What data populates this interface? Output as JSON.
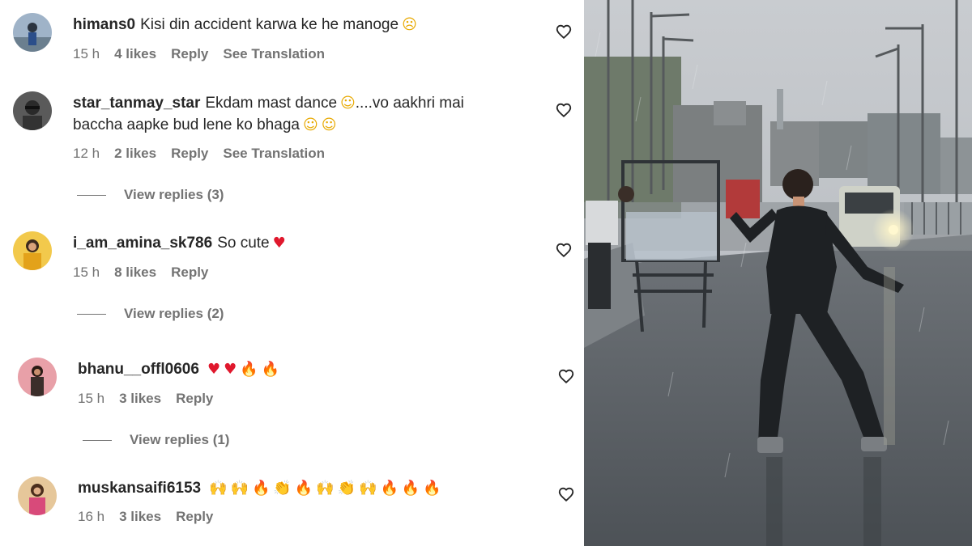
{
  "comments": [
    {
      "username": "himans0",
      "text": "Kisi din accident karwa ke he manoge",
      "emojis": [
        {
          "glyph": "☹",
          "kind": "yellow"
        }
      ],
      "time": "15 h",
      "likes": "4 likes",
      "reply": "Reply",
      "translate": "See Translation"
    },
    {
      "username": "star_tanmay_star",
      "text": "Ekdam mast dance",
      "emojis": [
        {
          "glyph": "☺",
          "kind": "yellow"
        }
      ],
      "text2": "....vo aakhri mai",
      "line2": "baccha aapke bud lene ko bhaga",
      "line2_emojis": [
        {
          "glyph": "☺",
          "kind": "yellow"
        },
        {
          "glyph": "☺",
          "kind": "yellow"
        }
      ],
      "time": "12 h",
      "likes": "2 likes",
      "reply": "Reply",
      "translate": "See Translation",
      "view_replies": "View replies (3)"
    },
    {
      "username": "i_am_amina_sk786",
      "text": "So cute",
      "emojis": [
        {
          "glyph": "♥",
          "kind": "red"
        }
      ],
      "time": "15 h",
      "likes": "8 likes",
      "reply": "Reply",
      "view_replies": "View replies (2)"
    },
    {
      "username": "bhanu__offl0606",
      "text": "",
      "emojis": [
        {
          "glyph": "♥",
          "kind": "red"
        },
        {
          "glyph": "♥",
          "kind": "red"
        },
        {
          "glyph": "🔥",
          "kind": "fire"
        },
        {
          "glyph": "🔥",
          "kind": "fire"
        }
      ],
      "time": "15 h",
      "likes": "3 likes",
      "reply": "Reply",
      "view_replies": "View replies (1)"
    },
    {
      "username": "muskansaifi6153",
      "text": "",
      "emojis": [
        {
          "glyph": "🙌",
          "kind": "yellow"
        },
        {
          "glyph": "🙌",
          "kind": "yellow"
        },
        {
          "glyph": "🔥",
          "kind": "fire"
        },
        {
          "glyph": "👏",
          "kind": "yellow"
        },
        {
          "glyph": "🔥",
          "kind": "fire"
        },
        {
          "glyph": "🙌",
          "kind": "yellow"
        },
        {
          "glyph": "👏",
          "kind": "yellow"
        },
        {
          "glyph": "🙌",
          "kind": "yellow"
        },
        {
          "glyph": "🔥",
          "kind": "fire"
        },
        {
          "glyph": "🔥",
          "kind": "fire"
        },
        {
          "glyph": "🔥",
          "kind": "fire"
        }
      ],
      "time": "16 h",
      "likes": "3 likes",
      "reply": "Reply"
    }
  ],
  "colors": {
    "text": "#262626",
    "meta": "#737373",
    "heart_red": "#e0182d",
    "fire": "#f06b0c"
  },
  "icons": {
    "like": "heart-outline-icon",
    "avatar": "profile-avatar"
  }
}
